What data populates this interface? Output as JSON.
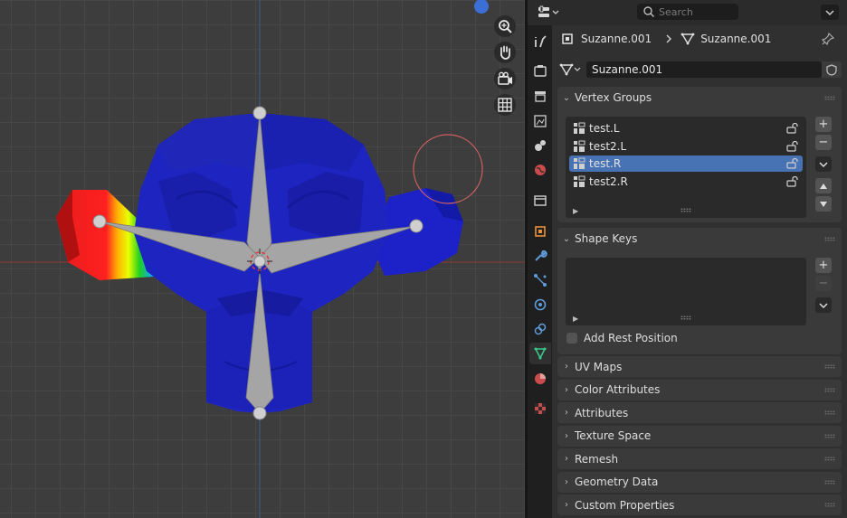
{
  "header": {
    "search_placeholder": "Search"
  },
  "breadcrumb": {
    "object_name": "Suzanne.001",
    "mesh_name": "Suzanne.001"
  },
  "datablock": {
    "name": "Suzanne.001"
  },
  "panels": {
    "vertex_groups": {
      "title": "Vertex Groups",
      "items": [
        {
          "label": "test.L",
          "selected": false
        },
        {
          "label": "test2.L",
          "selected": false
        },
        {
          "label": "test.R",
          "selected": true
        },
        {
          "label": "test2.R",
          "selected": false
        }
      ]
    },
    "shape_keys": {
      "title": "Shape Keys",
      "add_rest_position": "Add Rest Position"
    },
    "collapsed": [
      "UV Maps",
      "Color Attributes",
      "Attributes",
      "Texture Space",
      "Remesh",
      "Geometry Data",
      "Custom Properties"
    ]
  },
  "colors": {
    "selection": "#4772b3",
    "mesh_weight_zero": "#1a1aa0",
    "mesh_weight_one": "#e01b1b",
    "active_tab_icon": "#38c98b"
  },
  "viewport_navigation": [
    "zoom-icon",
    "hand-pan-icon",
    "camera-icon",
    "grid-icon"
  ]
}
